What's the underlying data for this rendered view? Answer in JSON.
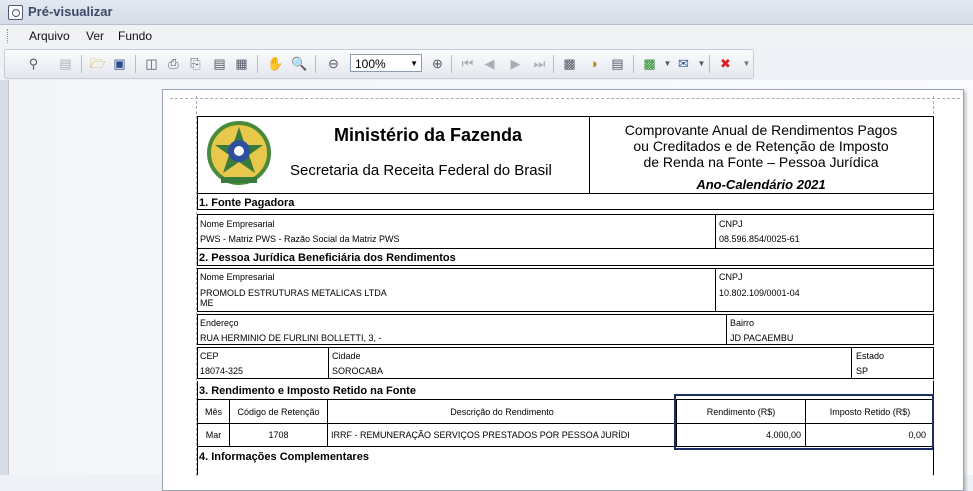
{
  "window": {
    "title": "Pré-visualizar"
  },
  "menu": {
    "file": "Arquivo",
    "view": "Ver",
    "background": "Fundo"
  },
  "toolbar": {
    "zoom": "100%"
  },
  "header": {
    "ministry": "Ministério da Fazenda",
    "secretariat": "Secretaria da Receita Federal do Brasil",
    "doc_title_1": "Comprovante Anual de Rendimentos Pagos",
    "doc_title_2": "ou Creditados e de Retenção de Imposto",
    "doc_title_3": "de Renda na Fonte – Pessoa Jurídica",
    "year": "Ano-Calendário  2021"
  },
  "section1": {
    "title": "1. Fonte Pagadora",
    "name_label": "Nome Empresarial",
    "name_value": "PWS - Matriz PWS - Razão Social da Matriz PWS",
    "cnpj_label": "CNPJ",
    "cnpj_value": "08.596.854/0025-61"
  },
  "section2": {
    "title": "2. Pessoa Jurídica Beneficiária dos Rendimentos",
    "name_label": "Nome Empresarial",
    "name_value_1": "PROMOLD ESTRUTURAS METALICAS LTDA",
    "name_value_2": "ME",
    "cnpj_label": "CNPJ",
    "cnpj_value": "10.802.109/0001-04",
    "address_label": "Endereço",
    "address_value": "RUA HERMINIO DE FURLINI BOLLETTI, 3,  -",
    "district_label": "Bairro",
    "district_value": "JD PACAEMBU",
    "cep_label": "CEP",
    "cep_value": "18074-325",
    "city_label": "Cidade",
    "city_value": "SOROCABA",
    "state_label": "Estado",
    "state_value": "SP"
  },
  "section3": {
    "title": "3. Rendimento e Imposto Retido na Fonte",
    "headers": {
      "month": "Mês",
      "code": "Código de Retenção",
      "desc": "Descrição do Rendimento",
      "income": "Rendimento (R$)",
      "tax": "Imposto Retido (R$)"
    },
    "row": {
      "month": "Mar",
      "code": "1708",
      "desc": "IRRF - REMUNERAÇÃO SERVIÇOS PRESTADOS POR PESSOA JURÍDI",
      "income": "4.000,00",
      "tax": "0,00"
    }
  },
  "section4": {
    "title": "4. Informações Complementares"
  }
}
